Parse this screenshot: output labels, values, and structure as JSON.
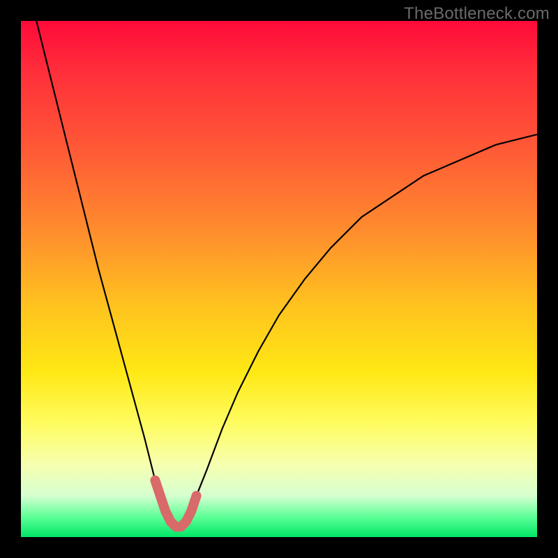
{
  "watermark": "TheBottleneck.com",
  "chart_data": {
    "type": "line",
    "title": "",
    "xlabel": "",
    "ylabel": "",
    "xlim": [
      0,
      100
    ],
    "ylim": [
      0,
      100
    ],
    "grid": false,
    "series": [
      {
        "name": "bottleneck-curve",
        "x": [
          3,
          6,
          9,
          12,
          15,
          18,
          21,
          24,
          26,
          27,
          28,
          29,
          30,
          31,
          32,
          33,
          34,
          36,
          39,
          42,
          46,
          50,
          55,
          60,
          66,
          72,
          78,
          85,
          92,
          100
        ],
        "values": [
          100,
          88,
          76,
          64,
          52,
          41,
          30,
          19,
          11,
          8,
          5,
          3,
          2,
          2,
          3,
          5,
          8,
          13,
          21,
          28,
          36,
          43,
          50,
          56,
          62,
          66,
          70,
          73,
          76,
          78
        ]
      },
      {
        "name": "minimum-highlight",
        "x": [
          26,
          27,
          28,
          29,
          30,
          31,
          32,
          33,
          34
        ],
        "values": [
          11,
          8,
          5,
          3,
          2,
          2,
          3,
          5,
          8
        ]
      }
    ],
    "colors": {
      "curve": "#000000",
      "highlight": "#d96a6a"
    }
  }
}
